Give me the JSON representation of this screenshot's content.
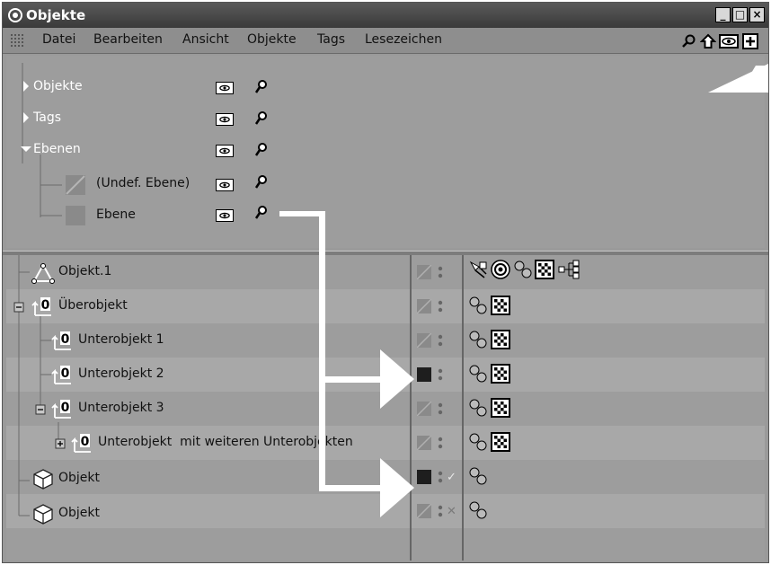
{
  "window": {
    "title": "Objekte",
    "buttons": [
      "_",
      "□",
      "×"
    ]
  },
  "menu": {
    "items": [
      "Datei",
      "Bearbeiten",
      "Ansicht",
      "Objekte",
      "Tags",
      "Lesezeichen"
    ],
    "toolbar_icons": [
      "search-icon",
      "home-icon",
      "eye-icon",
      "add-icon"
    ]
  },
  "layer_browser": {
    "rows": [
      {
        "label": "Objekte",
        "expand": "collapsed"
      },
      {
        "label": "Tags",
        "expand": "collapsed"
      },
      {
        "label": "Ebenen",
        "expand": "expanded"
      },
      {
        "label": "(Undef. Ebene)",
        "swatch": "undefined"
      },
      {
        "label": "Ebene",
        "swatch": "filled"
      }
    ]
  },
  "object_manager": {
    "rows": [
      {
        "label": "Objekt.1",
        "icon": "null-triangle-icon",
        "layer": "gray",
        "check": "",
        "tags": [
          "display-tag-icon",
          "target-tag-icon",
          "phong-tag-icon",
          "texture-tag-icon",
          "xpresso-tag-icon"
        ]
      },
      {
        "label": "Überobjekt",
        "icon": "null-object-icon",
        "layer": "gray",
        "check": "",
        "tags": [
          "phong-tag-icon",
          "texture-tag-icon"
        ]
      },
      {
        "label": "Unterobjekt 1",
        "icon": "null-object-icon",
        "layer": "gray",
        "check": "",
        "tags": [
          "phong-tag-icon",
          "texture-tag-icon"
        ]
      },
      {
        "label": "Unterobjekt 2",
        "icon": "null-object-icon",
        "layer": "black",
        "check": "",
        "tags": [
          "phong-tag-icon",
          "texture-tag-icon"
        ]
      },
      {
        "label": "Unterobjekt 3",
        "icon": "null-object-icon",
        "layer": "gray",
        "check": "",
        "tags": [
          "phong-tag-icon",
          "texture-tag-icon"
        ]
      },
      {
        "label": "Unterobjekt  mit weiteren Unterobjekten",
        "icon": "null-object-icon",
        "layer": "gray",
        "check": "",
        "tags": [
          "phong-tag-icon",
          "texture-tag-icon"
        ]
      },
      {
        "label": "Objekt",
        "icon": "cube-icon",
        "layer": "black",
        "check": "✓",
        "tags": [
          "phong-tag-icon"
        ]
      },
      {
        "label": "Objekt",
        "icon": "cube-icon",
        "layer": "gray",
        "check": "✕",
        "tags": [
          "phong-tag-icon"
        ]
      }
    ]
  },
  "colors": {
    "panel": "#9d9d9d",
    "titlebar": "#3a3a3a",
    "arrow": "#ffffff"
  }
}
